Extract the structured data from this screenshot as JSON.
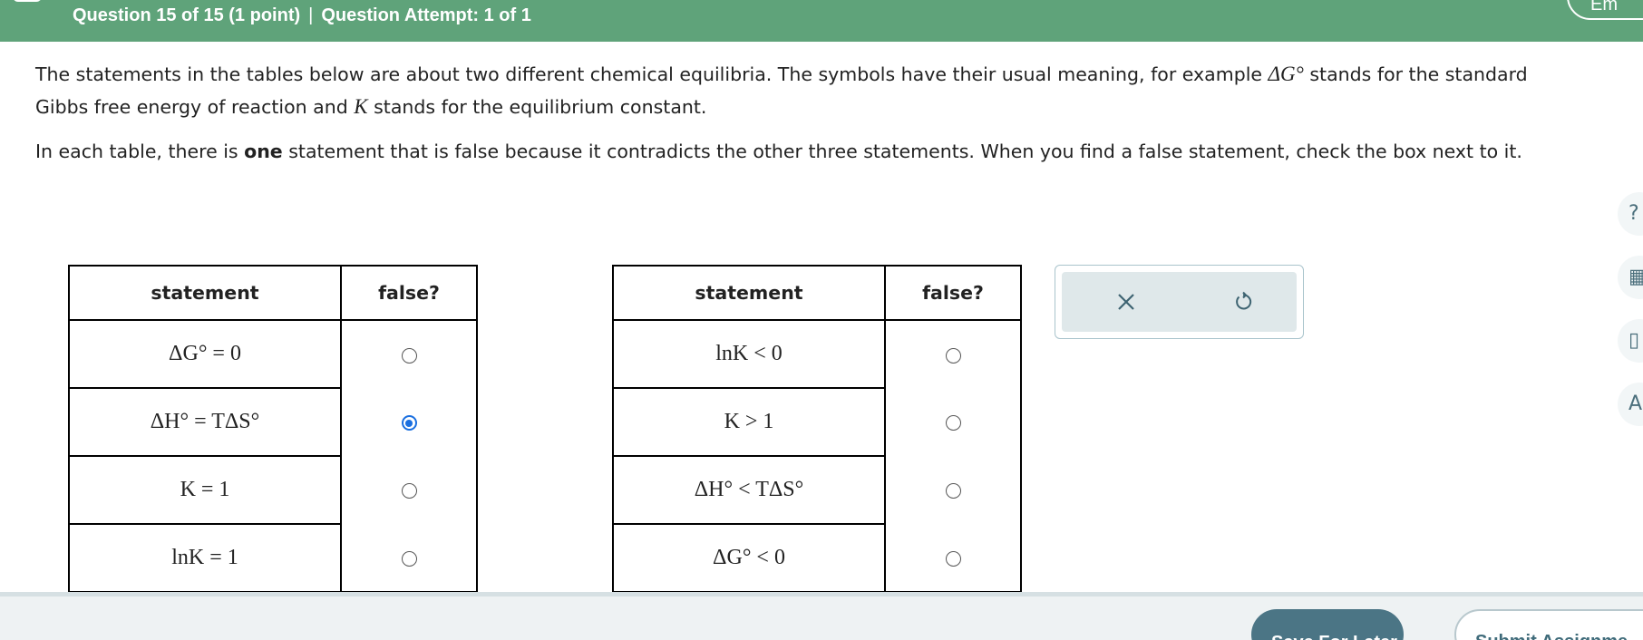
{
  "header": {
    "question_info": "Question 15 of 15 (1 point)",
    "separator": "|",
    "attempt_info": "Question Attempt: 1 of 1",
    "top_right_label": "Em"
  },
  "intro": {
    "p1_a": "The statements in the tables below are about two different chemical equilibria. The symbols have their usual meaning, for example ",
    "p1_math1": "ΔG°",
    "p1_b": " stands for the standard Gibbs free energy of reaction and ",
    "p1_math2": "K",
    "p1_c": " stands for the equilibrium constant.",
    "p2_a": "In each table, there is ",
    "p2_bold": "one",
    "p2_b": " statement that is false because it contradicts the other three statements. When you find a false statement, check the box next to it."
  },
  "table1": {
    "col_statement": "statement",
    "col_false": "false?",
    "rows": [
      {
        "statement": "ΔG° = 0",
        "checked": false
      },
      {
        "statement": "ΔH° = TΔS°",
        "checked": true
      },
      {
        "statement": "K = 1",
        "checked": false
      },
      {
        "statement": "lnK = 1",
        "checked": false
      }
    ]
  },
  "table2": {
    "col_statement": "statement",
    "col_false": "false?",
    "rows": [
      {
        "statement": "lnK < 0",
        "checked": false
      },
      {
        "statement": "K > 1",
        "checked": false
      },
      {
        "statement": "ΔH° < TΔS°",
        "checked": false
      },
      {
        "statement": "ΔG° < 0",
        "checked": false
      }
    ]
  },
  "tools": {
    "clear_icon": "close-icon",
    "undo_icon": "undo-icon"
  },
  "side_icons": [
    "help-icon",
    "calculator-icon",
    "chart-icon",
    "periodic-table-icon"
  ],
  "footer": {
    "save_label": "Save For Later",
    "submit_label": "Submit Assignme"
  },
  "colors": {
    "header_bg": "#5fa37a",
    "radio_checked": "#1a6fe0",
    "save_bg": "#4b7585"
  }
}
